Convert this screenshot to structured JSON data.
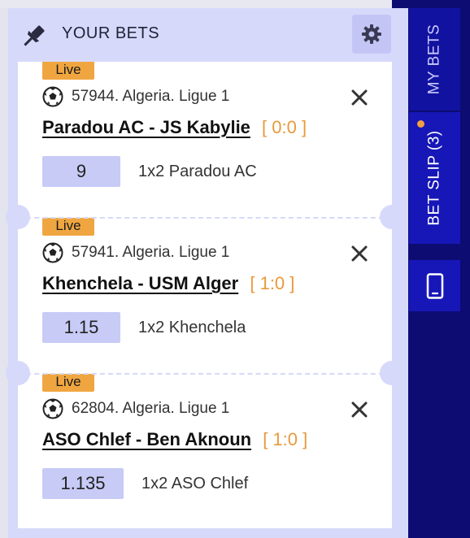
{
  "header": {
    "title": "YOUR BETS"
  },
  "nav": {
    "my_bets": "MY BETS",
    "bet_slip": "BET SLIP (3)"
  },
  "bets": [
    {
      "live": "Live",
      "league": "57944. Algeria. Ligue 1",
      "teams": "Paradou AC - JS Kabylie",
      "score": "[ 0:0 ]",
      "odds": "9",
      "pick": "1x2 Paradou AC"
    },
    {
      "live": "Live",
      "league": "57941. Algeria. Ligue 1",
      "teams": "Khenchela - USM Alger",
      "score": "[ 1:0 ]",
      "odds": "1.15",
      "pick": "1x2 Khenchela"
    },
    {
      "live": "Live",
      "league": "62804. Algeria. Ligue 1",
      "teams": "ASO Chlef - Ben Aknoun",
      "score": "[ 1:0 ]",
      "odds": "1.135",
      "pick": "1x2 ASO Chlef"
    }
  ],
  "colors": {
    "accent": "#f0a640",
    "navy": "#0c0c72",
    "panel": "#d7d9fb",
    "odds_bg": "#c7cbf6"
  },
  "icons": [
    "pin-icon",
    "gear-icon",
    "soccer-ball-icon",
    "close-icon",
    "mobile-device-icon"
  ]
}
